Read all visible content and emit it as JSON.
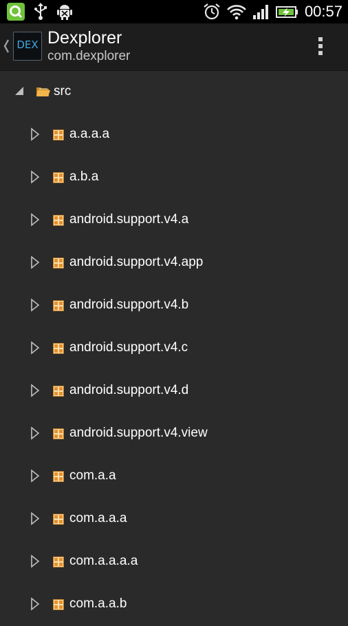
{
  "status_bar": {
    "time": "00:57",
    "icons_left": [
      "q-app-icon",
      "usb-icon",
      "android-debug-icon"
    ],
    "icons_right": [
      "alarm-icon",
      "wifi-icon",
      "signal-icon",
      "battery-charging-icon"
    ]
  },
  "action_bar": {
    "app_icon_text": "DEX",
    "title": "Dexplorer",
    "subtitle": "com.dexplorer"
  },
  "tree": {
    "root": {
      "label": "src",
      "expanded": true
    },
    "packages": [
      {
        "label": "a.a.a.a"
      },
      {
        "label": "a.b.a"
      },
      {
        "label": "android.support.v4.a"
      },
      {
        "label": "android.support.v4.app"
      },
      {
        "label": "android.support.v4.b"
      },
      {
        "label": "android.support.v4.c"
      },
      {
        "label": "android.support.v4.d"
      },
      {
        "label": "android.support.v4.view"
      },
      {
        "label": "com.a.a"
      },
      {
        "label": "com.a.a.a"
      },
      {
        "label": "com.a.a.a.a"
      },
      {
        "label": "com.a.a.b"
      }
    ]
  },
  "colors": {
    "background": "#2a2a2a",
    "action_bar": "#1d1d1d",
    "accent_blue": "#3fa7e0",
    "package_icon": "#e8a040",
    "folder_icon": "#f2b64a"
  }
}
